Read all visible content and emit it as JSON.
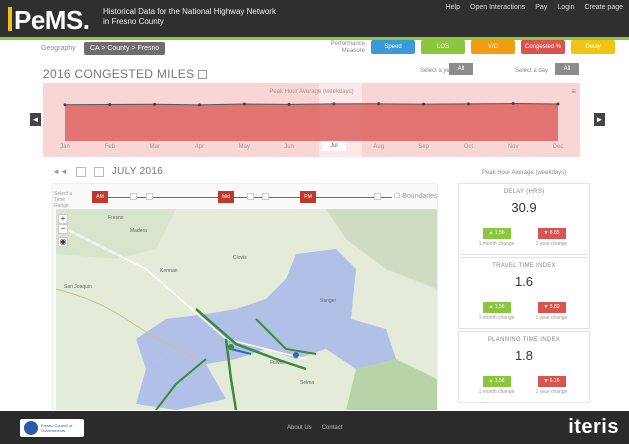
{
  "header": {
    "logo": "PeMS.",
    "subtitle_line1": "Historical Data for the National Highway Network",
    "subtitle_line2": "in Fresno County",
    "nav": [
      "Help",
      "Open Interactions",
      "Pay",
      "Login",
      "Create page"
    ]
  },
  "geography": {
    "label": "Geography",
    "value": "CA > County > Fresno"
  },
  "type_selector": {
    "label": "Performance Measure",
    "buttons": [
      {
        "label": "Speed",
        "color": "#3a9ad9"
      },
      {
        "label": "LOS",
        "color": "#8cc63f"
      },
      {
        "label": "V/C",
        "color": "#f39c12"
      },
      {
        "label": "Congested %",
        "color": "#d9534f"
      },
      {
        "label": "Delay",
        "color": "#f1c40f"
      }
    ]
  },
  "title": "2016 CONGESTED MILES",
  "selector_1": {
    "label": "Select a year",
    "value": "All"
  },
  "selector_2": {
    "label": "Select a day",
    "value": "All"
  },
  "chart": {
    "title": "Peak Hour Average (weekdays)",
    "months": [
      "Jan",
      "Feb",
      "Mar",
      "Apr",
      "May",
      "Jun",
      "Jul",
      "Aug",
      "Sep",
      "Oct",
      "Nov",
      "Dec"
    ],
    "active_month": "Jul"
  },
  "chart_data": {
    "type": "area",
    "title": "Peak Hour Average (weekdays)",
    "categories": [
      "Jan",
      "Feb",
      "Mar",
      "Apr",
      "May",
      "Jun",
      "Jul",
      "Aug",
      "Sep",
      "Oct",
      "Nov",
      "Dec"
    ],
    "values": [
      30.2,
      30.4,
      30.6,
      30.1,
      30.8,
      30.5,
      30.9,
      31.0,
      30.7,
      30.9,
      31.2,
      30.8
    ],
    "ylim": [
      0,
      40
    ],
    "color": "#d9534f"
  },
  "date_row": {
    "prev": "◄◄",
    "date": "JULY 2016"
  },
  "map_toolbar": {
    "label": "Select a Time Range",
    "buttons": [
      "AM\nPeak",
      "Mid\nDay",
      "PM\nPeak"
    ],
    "boundaries_label": "Boundaries"
  },
  "map_labels": [
    "Fresno",
    "Madera",
    "Clovis",
    "Sanger",
    "Kerman",
    "San Joaquin",
    "Selma",
    "Fowler"
  ],
  "right_panel": {
    "heading": "Peak Hour Average (weekdays)",
    "cards": [
      {
        "title": "DELAY (HRS)",
        "value": "30.9",
        "badge1": {
          "label": "▲ 1.56",
          "color": "#8cc63f"
        },
        "badge1_caption": "1 month change",
        "badge2": {
          "label": "▼ 8.85",
          "color": "#d9534f"
        },
        "badge2_caption": "1 year change"
      },
      {
        "title": "TRAVEL TIME INDEX",
        "value": "1.6",
        "badge1": {
          "label": "▲ 1.56",
          "color": "#8cc63f"
        },
        "badge1_caption": "1 month change",
        "badge2": {
          "label": "▼ 5.80",
          "color": "#d9534f"
        },
        "badge2_caption": "1 year change"
      },
      {
        "title": "PLANNING TIME INDEX",
        "value": "1.8",
        "badge1": {
          "label": "▲ 1.56",
          "color": "#8cc63f"
        },
        "badge1_caption": "1 month change",
        "badge2": {
          "label": "▼ 6.16",
          "color": "#d9534f"
        },
        "badge2_caption": "1 year change"
      }
    ]
  },
  "footer": {
    "partner_logo": "Fresno Council of Governments",
    "links": [
      "About Us",
      "Contact"
    ],
    "brand": "iteris"
  }
}
